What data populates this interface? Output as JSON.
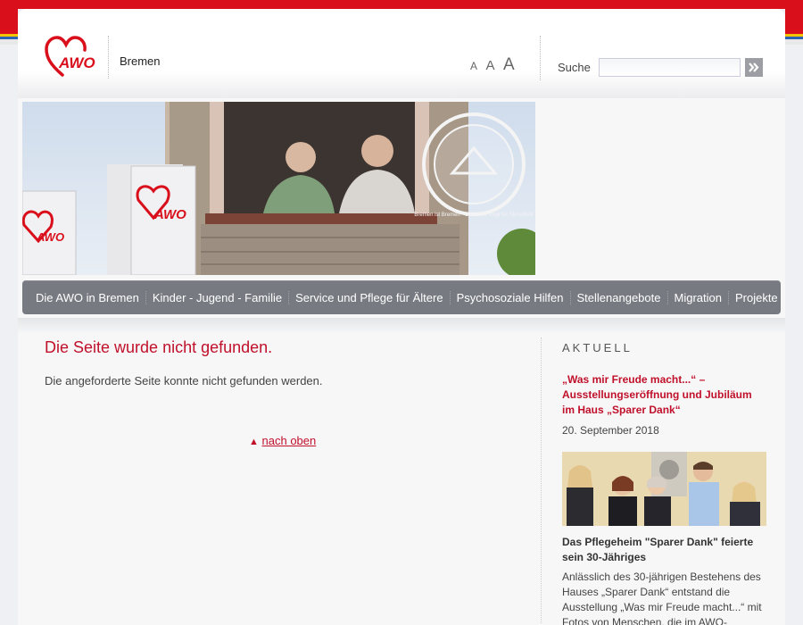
{
  "colors": {
    "brand_red": "#d90f1c",
    "title_red": "#c0102a",
    "nav_bg": "#777a80"
  },
  "header": {
    "logo_text": "AWO",
    "site_name": "Bremen",
    "font_sizes": [
      "A",
      "A",
      "A"
    ],
    "search": {
      "label": "Suche",
      "value": "",
      "button_icon": "double-chevron-right-icon"
    }
  },
  "hero": {
    "flag_text_1": "AWO",
    "flag_text_2": "AWO",
    "seal_text": "Bremen ist Bremen - Die AWO sorgt für Sicherheit"
  },
  "nav": {
    "items": [
      "Die AWO in Bremen",
      "Kinder - Jugend - Familie",
      "Service und Pflege für Ältere",
      "Psychosoziale Hilfen",
      "Stellenangebote",
      "Migration",
      "Projekte"
    ]
  },
  "main": {
    "title": "Die Seite wurde nicht gefunden.",
    "text": "Die angeforderte Seite konnte nicht gefunden werden.",
    "back_top_arrow": "▲",
    "back_top_link": "nach oben"
  },
  "sidebar": {
    "heading": "AKTUELL",
    "news": {
      "title": "„Was mir Freude macht...“ – Ausstellungseröffnung und Jubiläum im Haus „Sparer Dank“",
      "date": "20. September 2018",
      "subtitle": "Das Pflegeheim \"Sparer Dank\" feierte sein 30-Jähriges",
      "text": "Anlässlich des 30-jährigen Bestehens des Hauses „Sparer Dank“ entstand die Ausstellung „Was mir Freude macht...“ mit Fotos von Menschen, die im AWO-"
    }
  }
}
